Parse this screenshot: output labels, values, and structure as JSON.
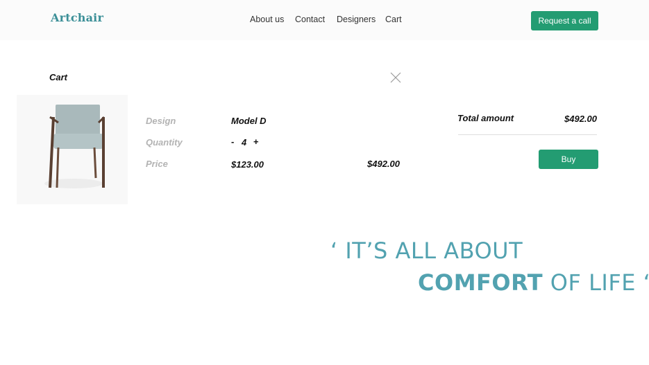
{
  "header": {
    "logo": "Artchair",
    "nav": {
      "about": "About us",
      "contact": "Contact",
      "designers": "Designers",
      "cart": "Cart"
    },
    "cta_label": "Request a call"
  },
  "cart": {
    "title": "Cart",
    "item": {
      "design_label": "Design",
      "design_value": "Model D",
      "quantity_label": "Quantity",
      "quantity_minus": "-",
      "quantity_value": "4",
      "quantity_plus": "+",
      "price_label": "Price",
      "price_value": "$123.00",
      "line_total": "$492.00"
    },
    "summary": {
      "total_label": "Total amount",
      "total_value": "$492.00",
      "buy_label": "Buy"
    }
  },
  "quote": {
    "line1": "‘ IT’S ALL ABOUT",
    "line2_bold": "COMFORT",
    "line2_rest": " OF LIFE ‘"
  },
  "colors": {
    "accent": "#239c72",
    "brand": "#3b8f97",
    "quote": "#52a2b0"
  },
  "icons": [
    "close-icon"
  ]
}
